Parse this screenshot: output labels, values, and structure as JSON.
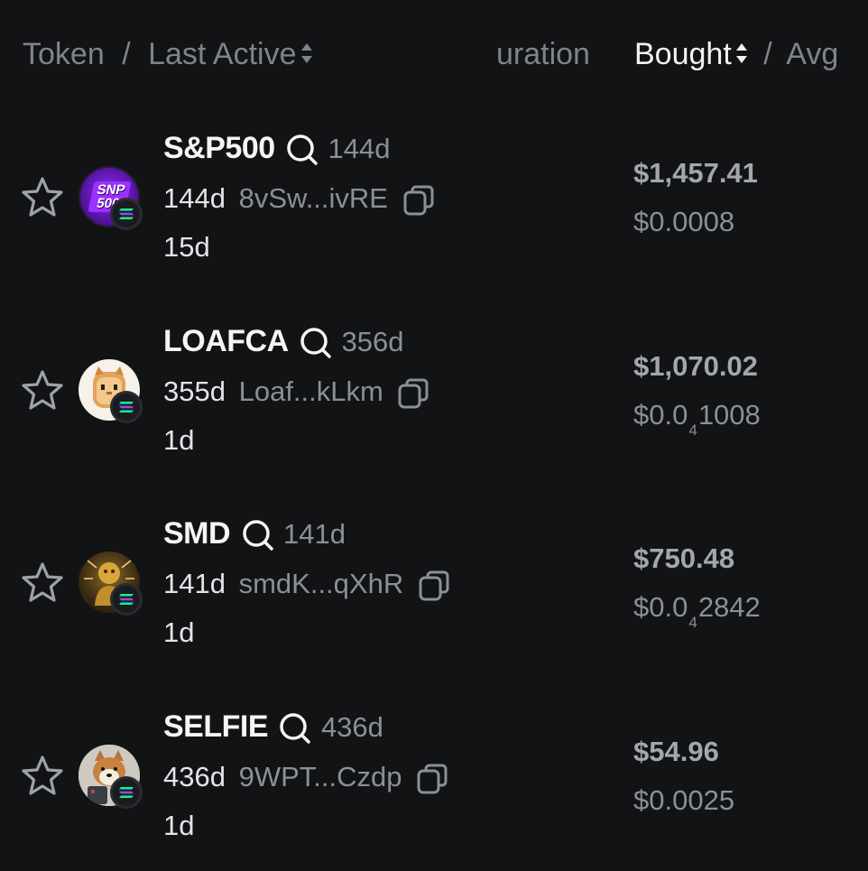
{
  "header": {
    "token_label": "Token",
    "separator": "/",
    "last_active_label": "Last Active",
    "duration_label": "uration",
    "bought_label": "Bought",
    "separator2": "/",
    "avg_label": "Avg"
  },
  "rows": [
    {
      "symbol": "S&P500",
      "created_age": "144d",
      "holding_age": "144d",
      "address": "8vSw...ivRE",
      "last_active": "15d",
      "bought": "$1,457.41",
      "avg_prefix": "$0.0008",
      "avg_sub": "",
      "avg_suffix": "",
      "avatar_text_1": "SNP",
      "avatar_text_2": "500"
    },
    {
      "symbol": "LOAFCA",
      "created_age": "356d",
      "holding_age": "355d",
      "address": "Loaf...kLkm",
      "last_active": "1d",
      "bought": "$1,070.02",
      "avg_prefix": "$0.0",
      "avg_sub": "4",
      "avg_suffix": "1008"
    },
    {
      "symbol": "SMD",
      "created_age": "141d",
      "holding_age": "141d",
      "address": "smdK...qXhR",
      "last_active": "1d",
      "bought": "$750.48",
      "avg_prefix": "$0.0",
      "avg_sub": "4",
      "avg_suffix": "2842"
    },
    {
      "symbol": "SELFIE",
      "created_age": "436d",
      "holding_age": "436d",
      "address": "9WPT...Czdp",
      "last_active": "1d",
      "bought": "$54.96",
      "avg_prefix": "$0.0025",
      "avg_sub": "",
      "avg_suffix": ""
    }
  ],
  "icons": {
    "star": "star-outline-icon",
    "search": "search-icon",
    "copy": "copy-icon",
    "sort": "sort-icon",
    "chain": "solana-icon"
  },
  "colors": {
    "background": "#121315",
    "muted_text": "#8b8f96",
    "primary_text": "#f4f5f7",
    "avatar_snp": "#6a1cc0"
  }
}
